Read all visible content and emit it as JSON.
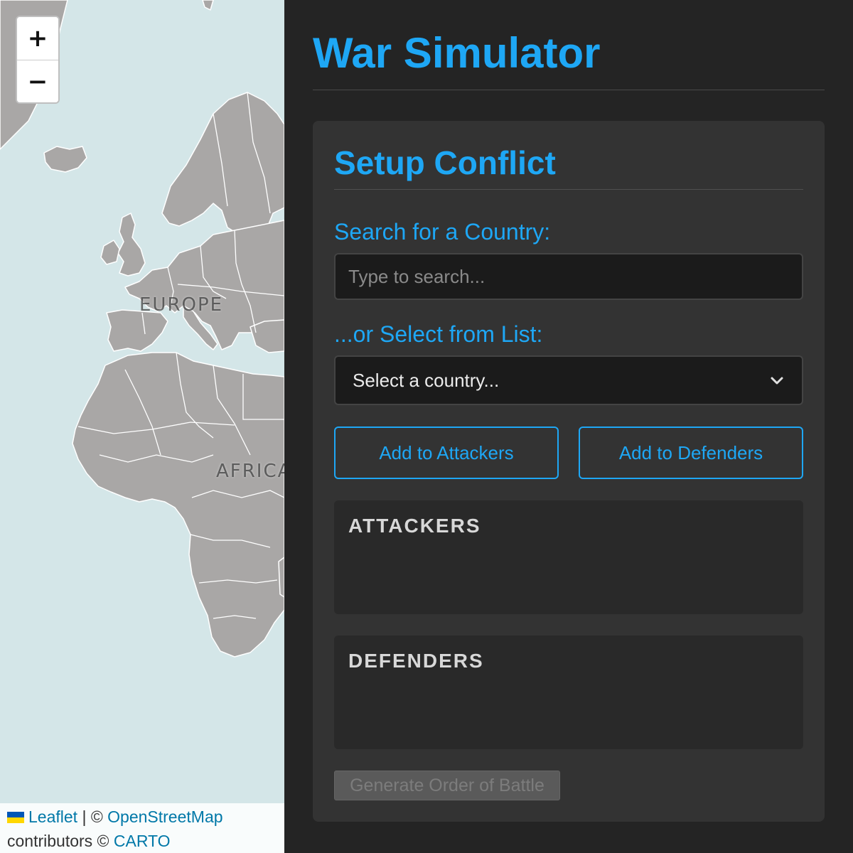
{
  "map": {
    "zoom_in_label": "+",
    "zoom_out_label": "−",
    "labels": {
      "europe": "EUROPE",
      "africa": "AFRICA"
    },
    "attribution": {
      "leaflet": "Leaflet",
      "sep": " | © ",
      "osm": "OpenStreetMap",
      "contributors": "contributors © ",
      "carto": "CARTO"
    },
    "colors": {
      "water": "#d4e6e8",
      "land": "#a9a7a6",
      "border": "#ffffff"
    }
  },
  "app": {
    "title": "War Simulator",
    "accent": "#1ea7f5"
  },
  "setup": {
    "title": "Setup Conflict",
    "search_label": "Search for a Country:",
    "search_placeholder": "Type to search...",
    "select_label": "...or Select from List:",
    "select_value": "Select a country...",
    "add_attackers": "Add to Attackers",
    "add_defenders": "Add to Defenders",
    "attackers_title": "ATTACKERS",
    "defenders_title": "DEFENDERS",
    "generate": "Generate Order of Battle"
  }
}
